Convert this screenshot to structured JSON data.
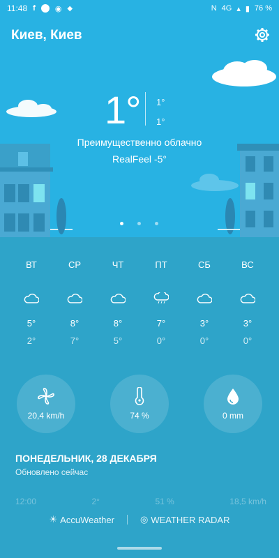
{
  "status_bar": {
    "time": "11:48",
    "network": "4G",
    "battery": "76 %"
  },
  "header": {
    "city": "Киев, Киев"
  },
  "current": {
    "temp": "1°",
    "high": "1°",
    "low": "1°",
    "condition": "Преимущественно облачно",
    "realfeel": "RealFeel -5°",
    "page_dots": 3,
    "active_dot": 0
  },
  "forecast": [
    {
      "day": "ВТ",
      "icon": "cloud-icon",
      "high": "5°",
      "low": "2°"
    },
    {
      "day": "СР",
      "icon": "cloud-icon",
      "high": "8°",
      "low": "7°"
    },
    {
      "day": "ЧТ",
      "icon": "cloud-icon",
      "high": "8°",
      "low": "5°"
    },
    {
      "day": "ПТ",
      "icon": "cloud-rain-icon",
      "high": "7°",
      "low": "0°"
    },
    {
      "day": "СБ",
      "icon": "cloud-icon",
      "high": "3°",
      "low": "0°"
    },
    {
      "day": "ВС",
      "icon": "cloud-icon",
      "high": "3°",
      "low": "0°"
    }
  ],
  "details": {
    "wind": "20,4 km/h",
    "humidity": "74 %",
    "precipitation": "0 mm"
  },
  "hourly": {
    "date": "ПОНЕДЕЛЬНИК, 28 ДЕКАБРЯ",
    "updated": "Обновлено сейчас",
    "faded_row": [
      "12:00",
      "2°",
      "51 %",
      "18,5 km/h"
    ]
  },
  "footer": {
    "accuweather": "AccuWeather",
    "radar": "WEATHER RADAR"
  },
  "colors": {
    "sky": "#28b2e3",
    "body": "#2ea4c9"
  }
}
